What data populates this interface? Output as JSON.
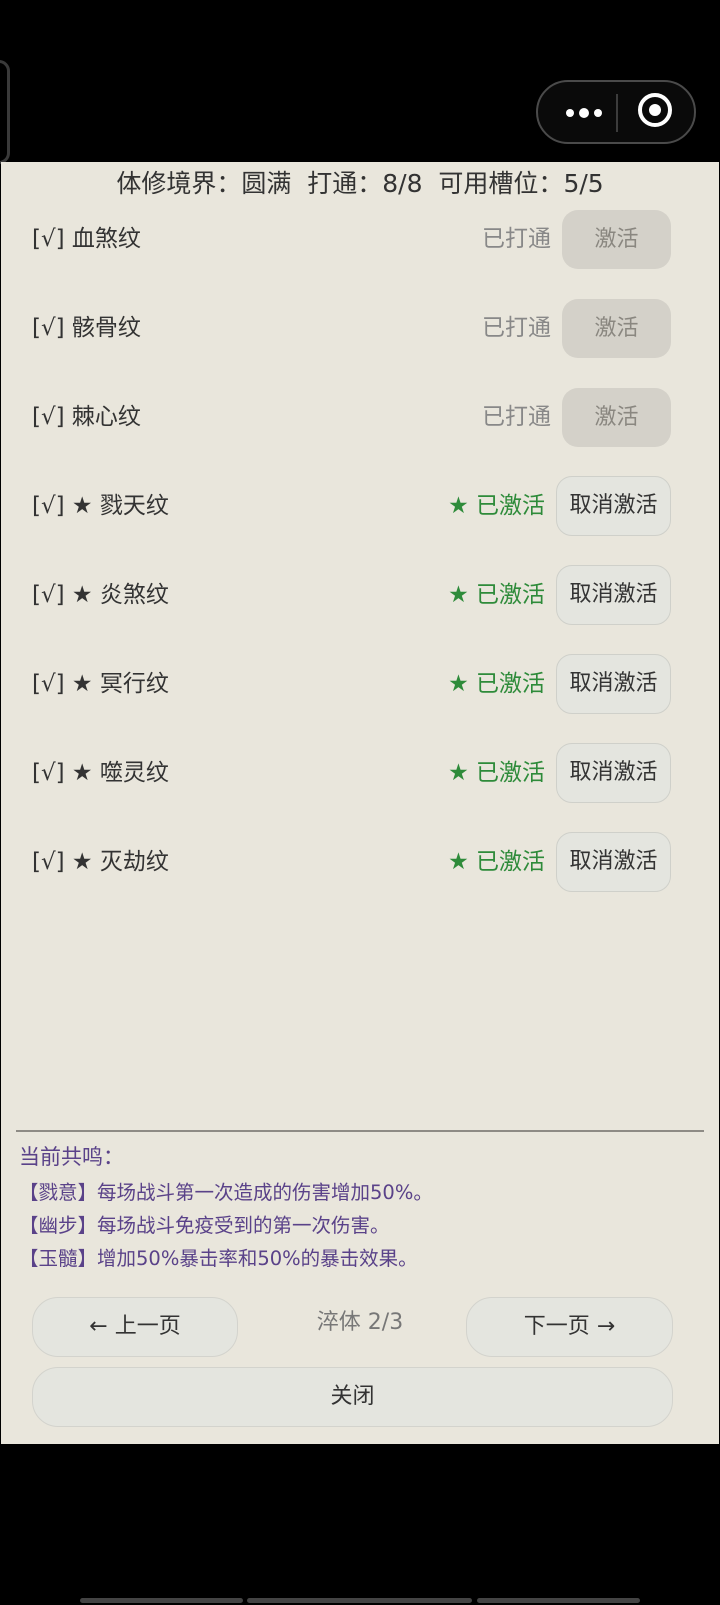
{
  "header": {
    "realm_label": "体修境界：",
    "realm_value": "圆满",
    "progress_label": "打通：",
    "progress_value": "8/8",
    "slots_label": "可用槽位：",
    "slots_value": "5/5"
  },
  "rows": [
    {
      "name": "[√] 血煞纹",
      "status": "已打通",
      "action": "激活",
      "starred": false
    },
    {
      "name": "[√] 骸骨纹",
      "status": "已打通",
      "action": "激活",
      "starred": false
    },
    {
      "name": "[√] 棘心纹",
      "status": "已打通",
      "action": "激活",
      "starred": false
    },
    {
      "name": "[√] ★ 戮天纹",
      "status": "★ 已激活",
      "action": "取消激活",
      "starred": true
    },
    {
      "name": "[√] ★ 炎煞纹",
      "status": "★ 已激活",
      "action": "取消激活",
      "starred": true
    },
    {
      "name": "[√] ★ 冥行纹",
      "status": "★ 已激活",
      "action": "取消激活",
      "starred": true
    },
    {
      "name": "[√] ★ 噬灵纹",
      "status": "★ 已激活",
      "action": "取消激活",
      "starred": true
    },
    {
      "name": "[√] ★ 灭劫纹",
      "status": "★ 已激活",
      "action": "取消激活",
      "starred": true
    }
  ],
  "resonance": {
    "title": "当前共鸣：",
    "lines": [
      "【戮意】每场战斗第一次造成的伤害增加50%。",
      "【幽步】每场战斗免疫受到的第一次伤害。",
      "【玉髓】增加50%暴击率和50%的暴击效果。"
    ]
  },
  "nav": {
    "prev_label": "← 上一页",
    "page_indicator": "淬体 2/3",
    "next_label": "下一页 →",
    "close_label": "关闭"
  },
  "colors": {
    "panel_bg": "#e9e6dc",
    "active_green": "#2e8b3a",
    "resonance_purple": "#5a4289"
  }
}
